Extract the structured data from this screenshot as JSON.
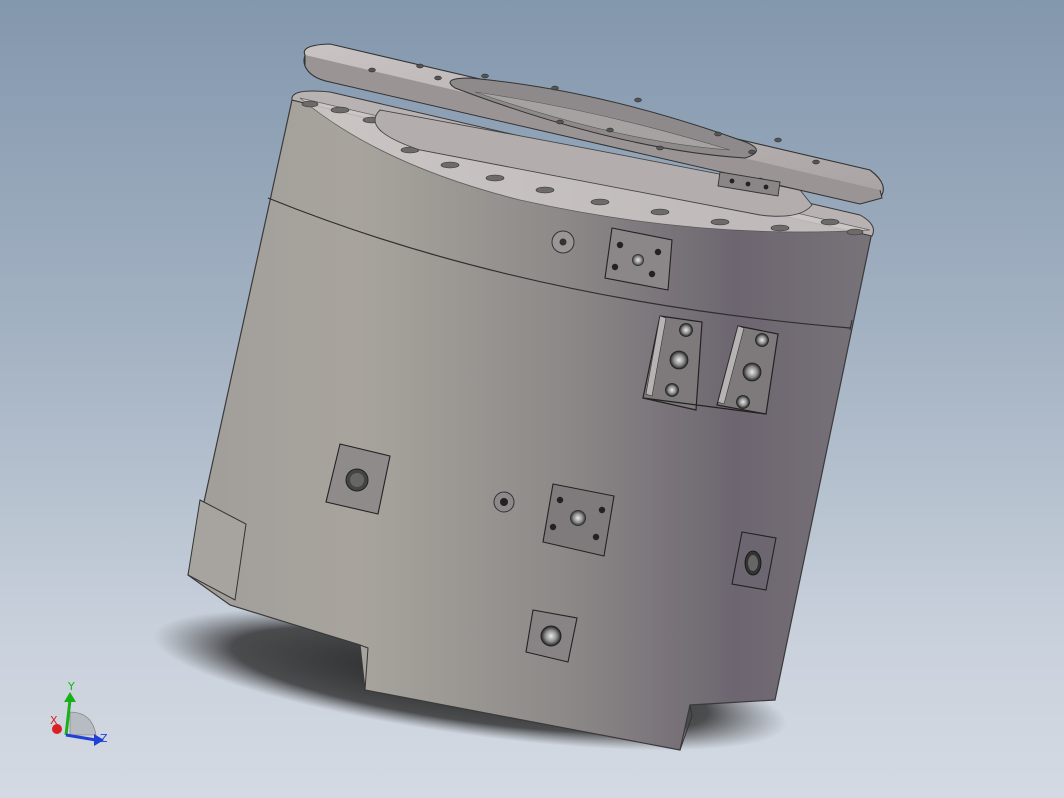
{
  "viewport": {
    "background_top": "#8397ad",
    "background_bottom": "#d4dae3"
  },
  "model": {
    "body_color": "#8f8a8b",
    "flange_color": "#c8c2c2"
  },
  "triad": {
    "x_label": "X",
    "y_label": "Y",
    "z_label": "Z",
    "x_color": "#d92121",
    "y_color": "#19b119",
    "z_color": "#1f3fd6"
  }
}
